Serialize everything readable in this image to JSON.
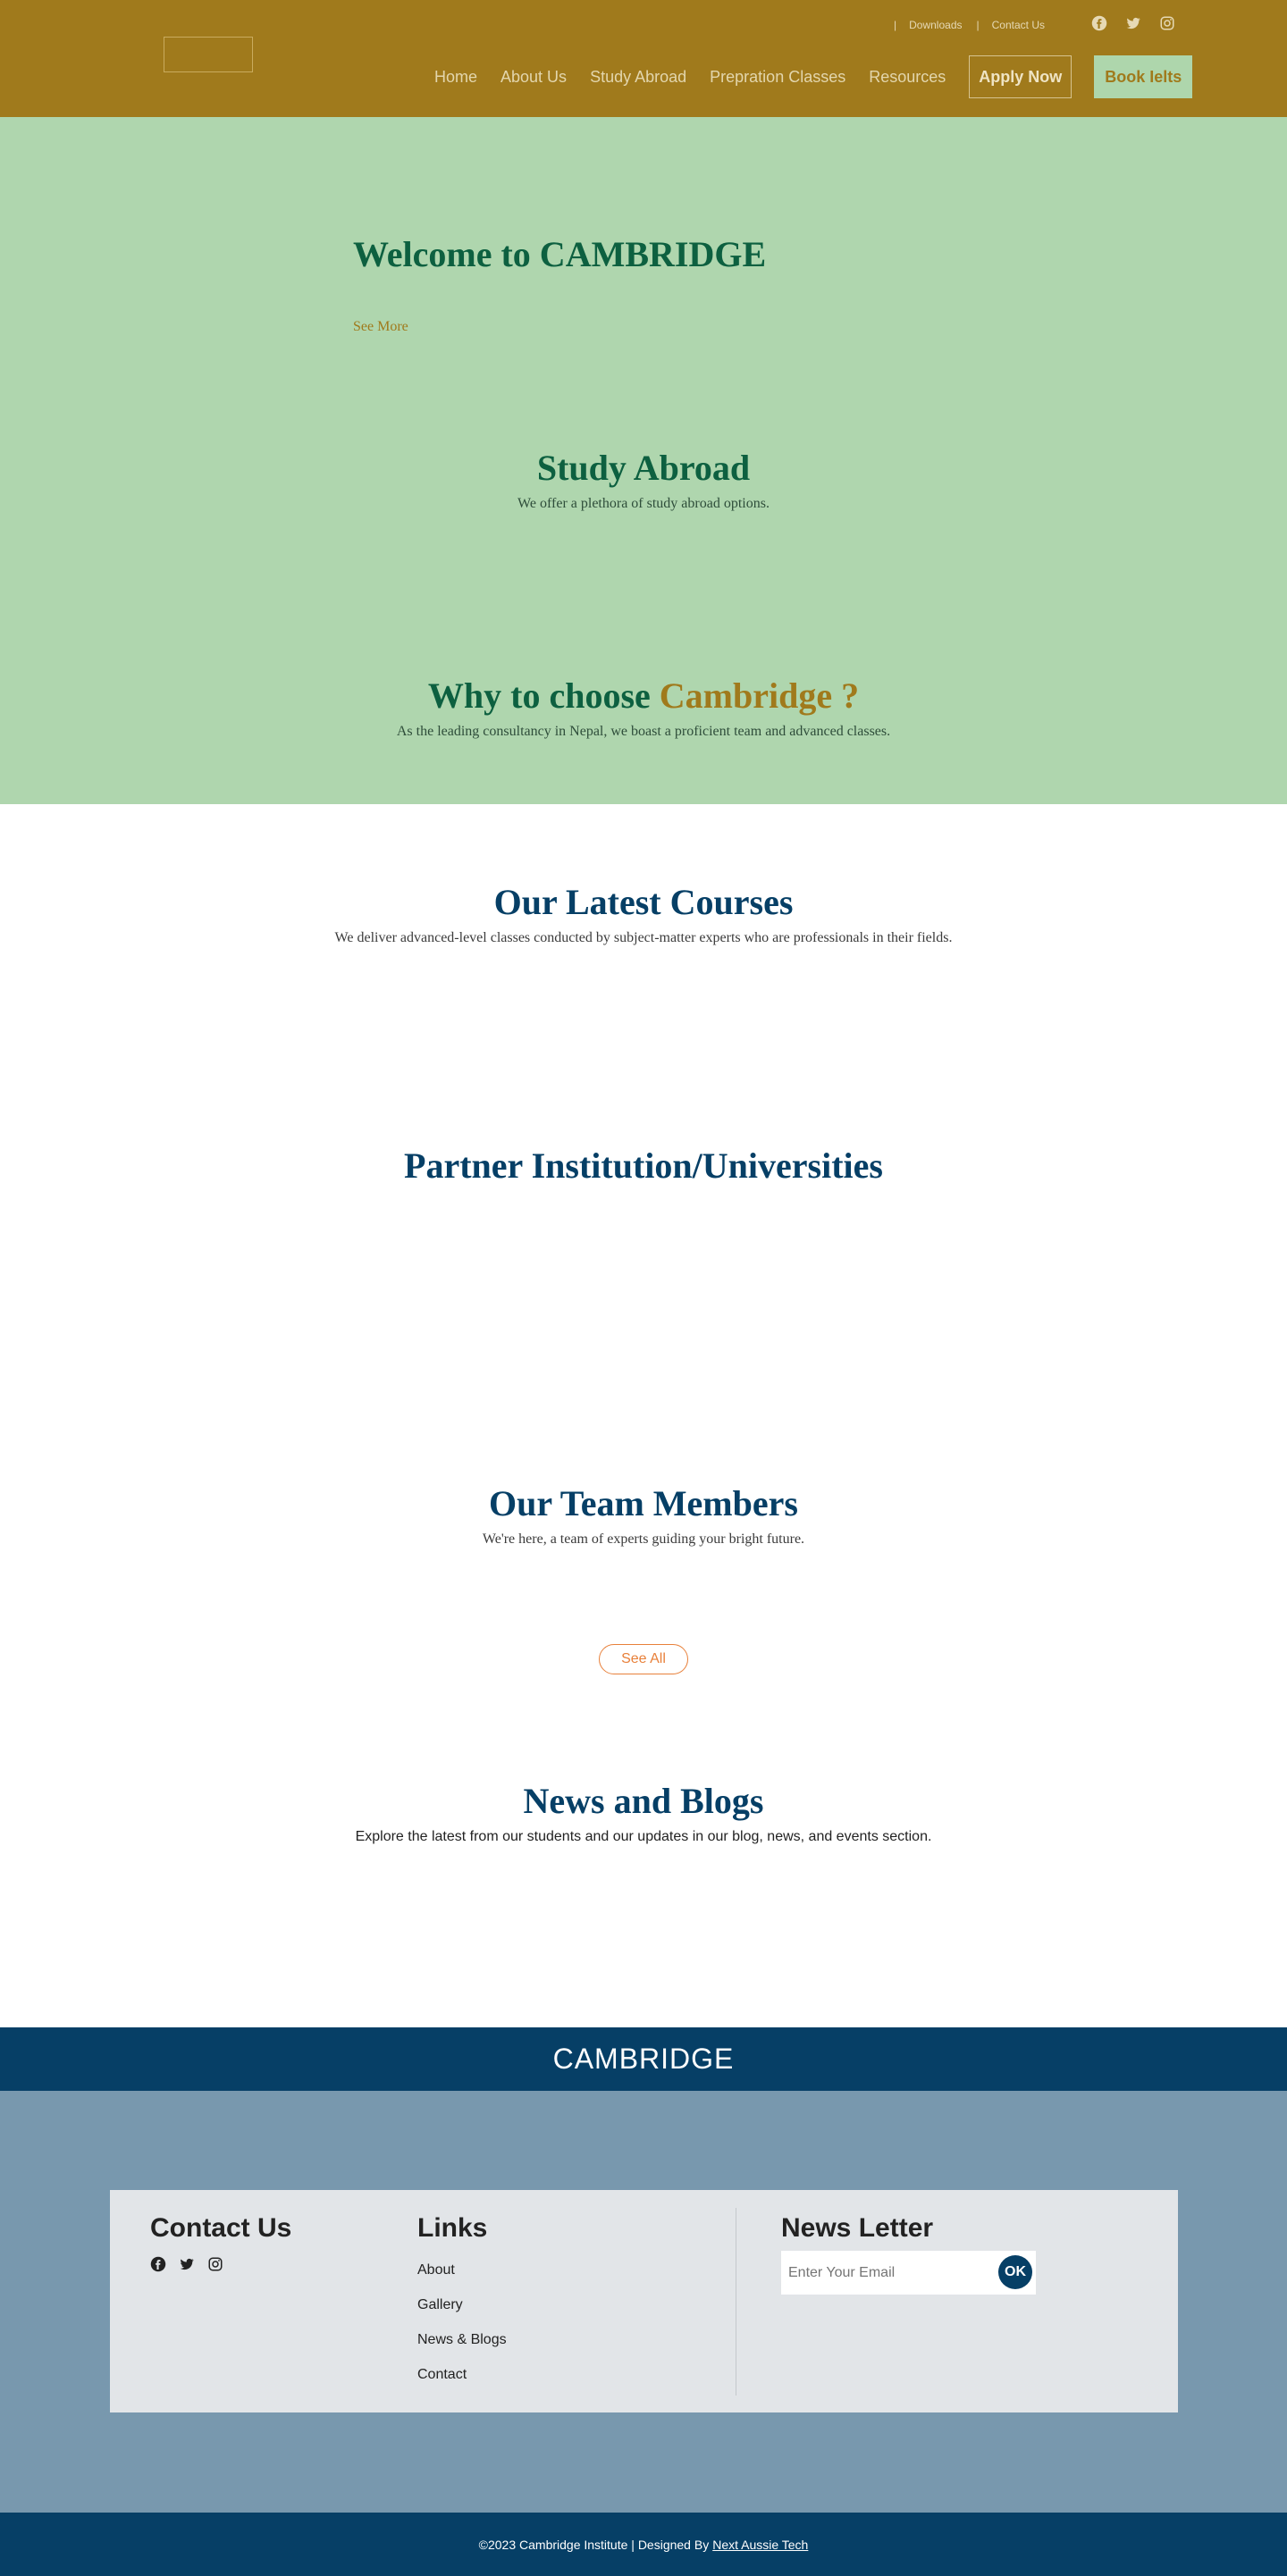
{
  "header": {
    "top_links": {
      "separator": "|",
      "downloads": "Downloads",
      "contact": "Contact Us"
    },
    "social": [
      "facebook-icon",
      "twitter-icon",
      "instagram-icon"
    ],
    "nav": [
      "Home",
      "About Us",
      "Study Abroad",
      "Prepration Classes",
      "Resources"
    ],
    "apply_label": "Apply Now",
    "book_label": "Book Ielts"
  },
  "hero": {
    "title": "Welcome to CAMBRIDGE",
    "see_more": "See More"
  },
  "study_abroad": {
    "title": "Study Abroad",
    "subtitle": "We offer a plethora of study abroad options."
  },
  "why": {
    "title_prefix": "Why to choose ",
    "title_highlight": "Cambridge ?",
    "subtitle": "As the leading consultancy in Nepal, we boast a proficient team and advanced classes."
  },
  "courses": {
    "title": "Our Latest Courses",
    "subtitle": "We deliver advanced-level classes conducted by subject-matter experts who are professionals in their fields."
  },
  "partners": {
    "title": "Partner Institution/Universities"
  },
  "team": {
    "title": "Our Team Members",
    "subtitle": "We're here, a team of experts guiding your bright future.",
    "see_all": "See All"
  },
  "news": {
    "title": "News and Blogs",
    "subtitle": "Explore the latest from our students and our updates in our blog, news, and events section."
  },
  "brand": "CAMBRIDGE",
  "footer": {
    "contact_title": "Contact Us",
    "links_title": "Links",
    "links": [
      "About",
      "Gallery",
      "News & Blogs",
      "Contact"
    ],
    "newsletter_title": "News Letter",
    "email_placeholder": "Enter Your Email",
    "ok_label": "OK"
  },
  "copyright": {
    "text": "©2023 Cambridge Institute | Designed By",
    "designer": "Next Aussie Tech"
  },
  "colors": {
    "header": "#a07a1c",
    "hero": "#afd6ae",
    "navy": "#063f66",
    "footer": "#7898ae",
    "accent_orange": "#e8803a"
  }
}
